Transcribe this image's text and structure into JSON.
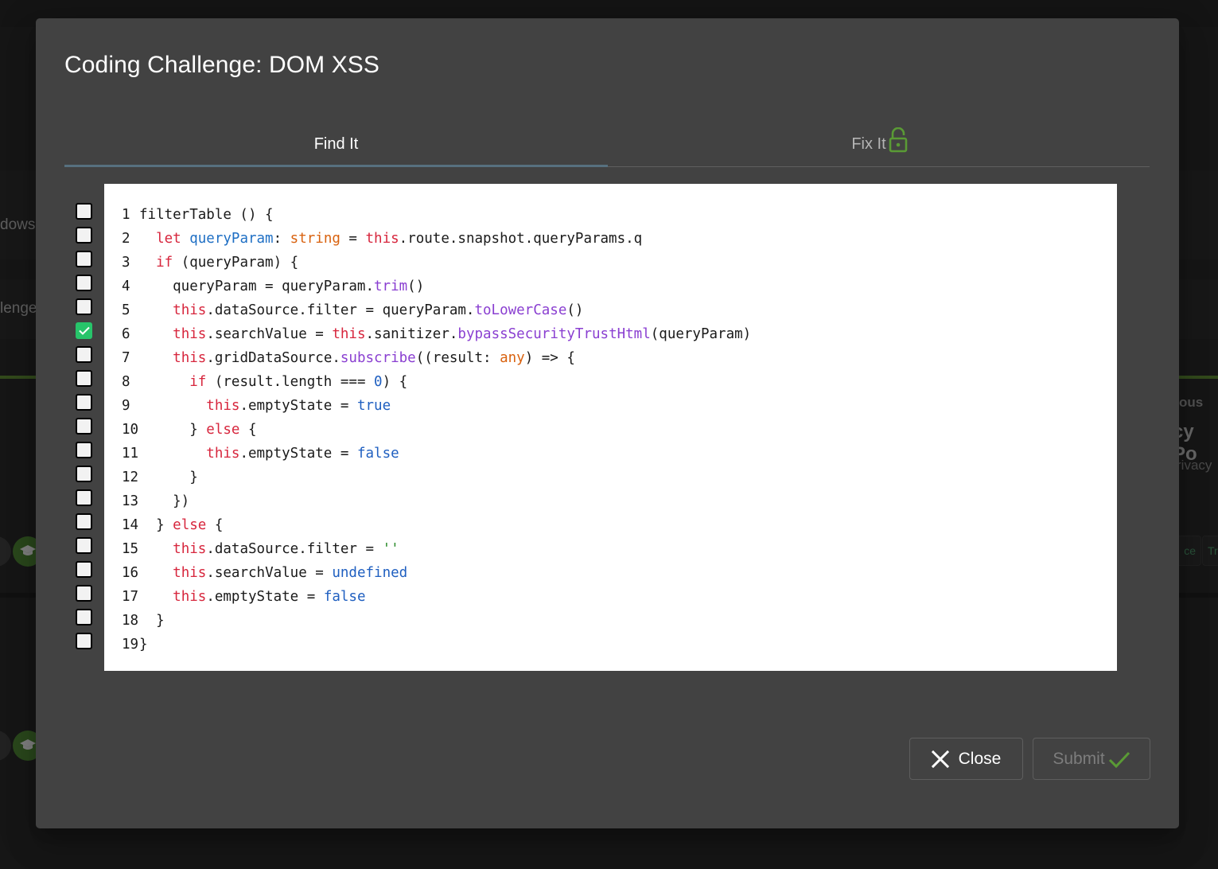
{
  "background": {
    "left_texts": [
      "dows",
      "lenge"
    ],
    "right_texts": [
      "ous",
      "cy Po",
      "rivacy"
    ],
    "right_chips": [
      "ce",
      "Tr"
    ]
  },
  "dialog": {
    "title": "Coding Challenge: DOM XSS",
    "tabs": [
      {
        "label": "Find It",
        "active": true
      },
      {
        "label": "Fix It",
        "active": false,
        "icon": "lock-open-icon"
      }
    ],
    "selected_line": 6,
    "code_lines": [
      {
        "n": "1",
        "tokens": [
          {
            "t": "filterTable () {"
          }
        ]
      },
      {
        "n": "2",
        "tokens": [
          {
            "t": "  "
          },
          {
            "t": "let",
            "c": "kw"
          },
          {
            "t": " "
          },
          {
            "t": "queryParam",
            "c": "var"
          },
          {
            "t": ": "
          },
          {
            "t": "string",
            "c": "type"
          },
          {
            "t": " = "
          },
          {
            "t": "this",
            "c": "kw"
          },
          {
            "t": ".route.snapshot.queryParams.q"
          }
        ]
      },
      {
        "n": "3",
        "tokens": [
          {
            "t": "  "
          },
          {
            "t": "if",
            "c": "kw"
          },
          {
            "t": " (queryParam) {"
          }
        ]
      },
      {
        "n": "4",
        "tokens": [
          {
            "t": "    queryParam = queryParam."
          },
          {
            "t": "trim",
            "c": "fn"
          },
          {
            "t": "()"
          }
        ]
      },
      {
        "n": "5",
        "tokens": [
          {
            "t": "    "
          },
          {
            "t": "this",
            "c": "kw"
          },
          {
            "t": ".dataSource.filter = queryParam."
          },
          {
            "t": "toLowerCase",
            "c": "fn"
          },
          {
            "t": "()"
          }
        ]
      },
      {
        "n": "6",
        "tokens": [
          {
            "t": "    "
          },
          {
            "t": "this",
            "c": "kw"
          },
          {
            "t": ".searchValue = "
          },
          {
            "t": "this",
            "c": "kw"
          },
          {
            "t": ".sanitizer."
          },
          {
            "t": "bypassSecurityTrustHtml",
            "c": "fn"
          },
          {
            "t": "(queryParam)"
          }
        ]
      },
      {
        "n": "7",
        "tokens": [
          {
            "t": "    "
          },
          {
            "t": "this",
            "c": "kw"
          },
          {
            "t": ".gridDataSource."
          },
          {
            "t": "subscribe",
            "c": "fn"
          },
          {
            "t": "((result: "
          },
          {
            "t": "any",
            "c": "type"
          },
          {
            "t": ") => {"
          }
        ]
      },
      {
        "n": "8",
        "tokens": [
          {
            "t": "      "
          },
          {
            "t": "if",
            "c": "kw"
          },
          {
            "t": " (result.length === "
          },
          {
            "t": "0",
            "c": "lit"
          },
          {
            "t": ") {"
          }
        ]
      },
      {
        "n": "9",
        "tokens": [
          {
            "t": "        "
          },
          {
            "t": "this",
            "c": "kw"
          },
          {
            "t": ".emptyState = "
          },
          {
            "t": "true",
            "c": "lit"
          }
        ]
      },
      {
        "n": "10",
        "tokens": [
          {
            "t": "      } "
          },
          {
            "t": "else",
            "c": "kw"
          },
          {
            "t": " {"
          }
        ]
      },
      {
        "n": "11",
        "tokens": [
          {
            "t": "        "
          },
          {
            "t": "this",
            "c": "kw"
          },
          {
            "t": ".emptyState = "
          },
          {
            "t": "false",
            "c": "lit"
          }
        ]
      },
      {
        "n": "12",
        "tokens": [
          {
            "t": "      }"
          }
        ]
      },
      {
        "n": "13",
        "tokens": [
          {
            "t": "    })"
          }
        ]
      },
      {
        "n": "14",
        "tokens": [
          {
            "t": "  } "
          },
          {
            "t": "else",
            "c": "kw"
          },
          {
            "t": " {"
          }
        ]
      },
      {
        "n": "15",
        "tokens": [
          {
            "t": "    "
          },
          {
            "t": "this",
            "c": "kw"
          },
          {
            "t": ".dataSource.filter = "
          },
          {
            "t": "''",
            "c": "str"
          }
        ]
      },
      {
        "n": "16",
        "tokens": [
          {
            "t": "    "
          },
          {
            "t": "this",
            "c": "kw"
          },
          {
            "t": ".searchValue = "
          },
          {
            "t": "undefined",
            "c": "lit"
          }
        ]
      },
      {
        "n": "17",
        "tokens": [
          {
            "t": "    "
          },
          {
            "t": "this",
            "c": "kw"
          },
          {
            "t": ".emptyState = "
          },
          {
            "t": "false",
            "c": "lit"
          }
        ]
      },
      {
        "n": "18",
        "tokens": [
          {
            "t": "  }"
          }
        ]
      },
      {
        "n": "19",
        "tokens": [
          {
            "t": "}"
          }
        ]
      }
    ],
    "buttons": {
      "close_label": "Close",
      "close_icon": "close-icon",
      "submit_label": "Submit",
      "submit_icon": "checkmark-icon",
      "submit_enabled": false
    }
  },
  "colors": {
    "dialog_bg": "#424242",
    "tab_indicator": "#57707f",
    "checkbox_checked": "#27c46a",
    "accent_green": "#5a9a35",
    "keyword": "#d7263d",
    "variable": "#1f6fc4",
    "type": "#d9620f",
    "function": "#8a3fd1",
    "literal": "#1f5fc0"
  }
}
